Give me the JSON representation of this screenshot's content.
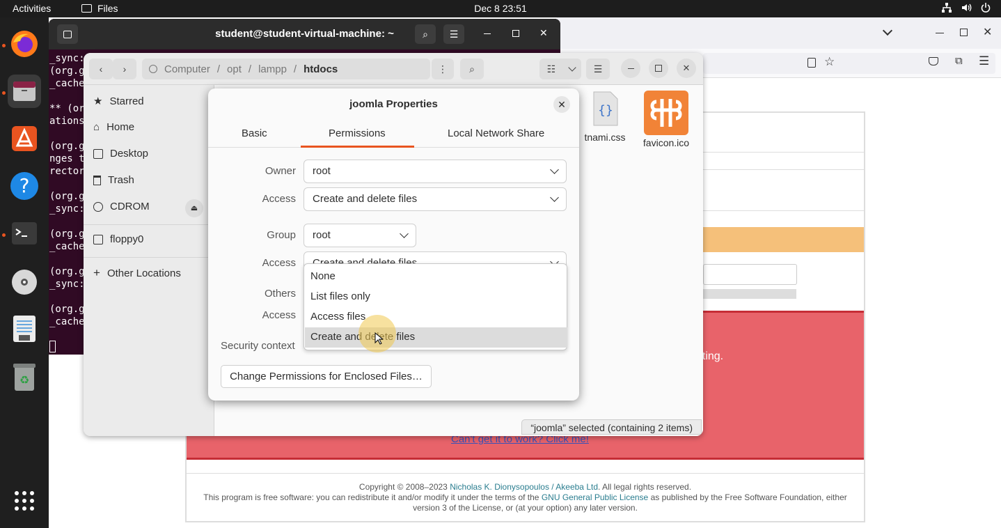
{
  "topbar": {
    "activities": "Activities",
    "app_name": "Files",
    "clock": "Dec 8  23:51",
    "tray_icons": [
      "network-icon",
      "volume-icon",
      "power-icon"
    ]
  },
  "dock": {
    "items": [
      "firefox-icon",
      "files-icon",
      "app-center-icon",
      "help-icon",
      "terminal-icon",
      "disc-icon",
      "text-editor-icon",
      "trash-icon",
      "show-apps-icon"
    ]
  },
  "terminal": {
    "title": "student@student-virtual-machine: ~",
    "lines": [
      "_sync:",
      "(org.g",
      "_cache",
      "",
      "** (or",
      "ations",
      "",
      "(org.g",
      "nges t",
      "rector",
      "",
      "(org.g",
      "_sync:",
      "",
      "(org.g",
      "_cache",
      "",
      "(org.g",
      "_sync:",
      "",
      "(org.g",
      "_cache"
    ]
  },
  "browser": {
    "footer_copyright": "Copyright © 2008–2023",
    "footer_author": "Nicholas K. Dionysopoulos / Akeeba Ltd",
    "footer_rights": ". All legal rights reserved.",
    "footer_license_pre": "This program is free software: you can redistribute it and/or modify it under the terms of the",
    "footer_license_link": "GNU General Public License",
    "footer_license_post": "as published by the Free Software Foundation, either",
    "footer_license_line2": "version 3 of the License, or (at your option) any later version.",
    "help_link": "Can't get it to work? Click me!",
    "writing_text": "riting."
  },
  "files": {
    "path": [
      "Computer",
      "opt",
      "lampp",
      "htdocs"
    ],
    "sidebar": [
      {
        "label": "Starred",
        "icon": "star-icon"
      },
      {
        "label": "Home",
        "icon": "home-icon"
      },
      {
        "label": "Desktop",
        "icon": "desktop-icon"
      },
      {
        "label": "Trash",
        "icon": "trash-icon"
      },
      {
        "label": "CDROM",
        "icon": "cdrom-icon"
      },
      {
        "label": "floppy0",
        "icon": "floppy-icon"
      },
      {
        "label": "Other Locations",
        "icon": "plus-icon"
      }
    ],
    "tiles": [
      {
        "label": "tnami.css",
        "icon": "css-file-icon"
      },
      {
        "label": "favicon.ico",
        "icon": "xampp-icon"
      }
    ],
    "status": "“joomla” selected  (containing 2 items)"
  },
  "dialog": {
    "title": "joomla Properties",
    "tabs": [
      "Basic",
      "Permissions",
      "Local Network Share"
    ],
    "active_tab": "Permissions",
    "owner_label": "Owner",
    "owner_value": "root",
    "owner_access_label": "Access",
    "owner_access_value": "Create and delete files",
    "group_label": "Group",
    "group_value": "root",
    "group_access_label": "Access",
    "group_access_value": "Create and delete files",
    "others_label": "Others",
    "others_access_label": "Access",
    "security_label": "Security context",
    "enclosed_button": "Change Permissions for Enclosed Files…"
  },
  "dropdown": {
    "options": [
      "None",
      "List files only",
      "Access files",
      "Create and delete files"
    ],
    "highlighted": "Create and delete files"
  },
  "colors": {
    "accent": "#e95420",
    "terminal_bg": "#300a24",
    "alert_red": "#e8636a",
    "alert_orange": "#f5c07a"
  }
}
